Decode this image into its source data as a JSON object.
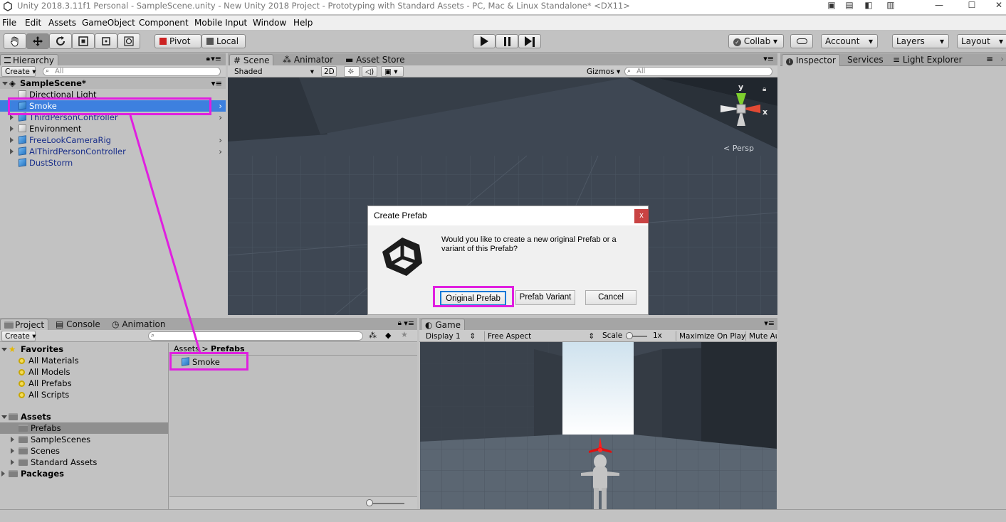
{
  "window": {
    "title": "Unity 2018.3.11f1 Personal - SampleScene.unity - New Unity 2018 Project - Prototyping with Standard Assets - PC, Mac & Linux Standalone* <DX11>"
  },
  "menu": [
    "File",
    "Edit",
    "Assets",
    "GameObject",
    "Component",
    "Mobile Input",
    "Window",
    "Help"
  ],
  "toolbar": {
    "pivot": "Pivot",
    "local": "Local",
    "collab": "Collab",
    "account": "Account",
    "layers": "Layers",
    "layout": "Layout"
  },
  "hierarchy": {
    "tab": "Hierarchy",
    "create": "Create",
    "search_placeholder": "All",
    "scene": "SampleScene*",
    "items": [
      {
        "label": "Directional Light",
        "icon": "gameobject-icon"
      },
      {
        "label": "Smoke",
        "icon": "prefab-icon"
      },
      {
        "label": "ThirdPersonController",
        "icon": "prefab-icon"
      },
      {
        "label": "Environment",
        "icon": "gameobject-icon"
      },
      {
        "label": "FreeLookCameraRig",
        "icon": "prefab-icon"
      },
      {
        "label": "AIThirdPersonController",
        "icon": "prefab-icon"
      },
      {
        "label": "DustStorm",
        "icon": "prefab-icon"
      }
    ]
  },
  "scene_tabs": {
    "scene": "Scene",
    "animator": "Animator",
    "asset_store": "Asset Store"
  },
  "scene_bar": {
    "shaded": "Shaded",
    "mode2d": "2D",
    "gizmos": "Gizmos",
    "search_placeholder": "All"
  },
  "gizmo": {
    "y": "y",
    "x": "x",
    "persp": "Persp"
  },
  "inspector_tabs": {
    "inspector": "Inspector",
    "services": "Services",
    "light_explorer": "Light Explorer"
  },
  "dialog": {
    "title": "Create Prefab",
    "close": "x",
    "message": "Would you like to create a new original Prefab or a variant of this Prefab?",
    "buttons": {
      "original": "Original Prefab",
      "variant": "Prefab Variant",
      "cancel": "Cancel"
    }
  },
  "project_tabs": {
    "project": "Project",
    "console": "Console",
    "animation": "Animation"
  },
  "project": {
    "create": "Create",
    "favorites": {
      "label": "Favorites",
      "items": [
        "All Materials",
        "All Models",
        "All Prefabs",
        "All Scripts"
      ]
    },
    "assets": {
      "label": "Assets",
      "items": [
        "Prefabs",
        "SampleScenes",
        "Scenes",
        "Standard Assets"
      ]
    },
    "packages": "Packages",
    "breadcrumb": {
      "root": "Assets",
      "sep": ">",
      "current": "Prefabs"
    },
    "files": [
      "Smoke"
    ]
  },
  "game": {
    "tab": "Game",
    "display": "Display 1",
    "aspect": "Free Aspect",
    "scale_label": "Scale",
    "scale_value": "1x",
    "maximize": "Maximize On Play",
    "mute": "Mute Au"
  },
  "colors": {
    "highlight": "#e01fe0",
    "selection": "#3d80df",
    "prefab_text": "#1a2f8a"
  }
}
